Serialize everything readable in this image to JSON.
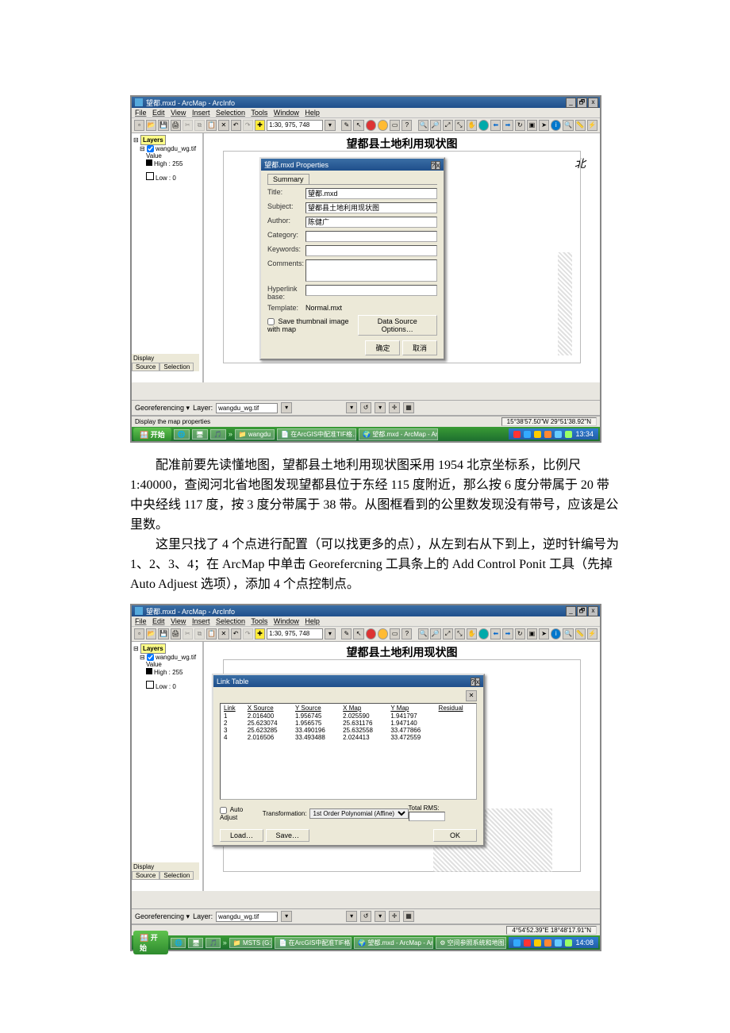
{
  "app": {
    "title": "望都.mxd - ArcMap - ArcInfo"
  },
  "win_ext": {
    "min": "_",
    "max": "🗗",
    "close": "x"
  },
  "menus": [
    "File",
    "Edit",
    "View",
    "Insert",
    "Selection",
    "Tools",
    "Window",
    "Help"
  ],
  "scale": "1:30, 975, 748",
  "toc": {
    "root": "Layers",
    "layer": "wangdu_wg.tif",
    "value_label": "Value",
    "high": "High : 255",
    "low": "Low : 0"
  },
  "toc_tabs": {
    "display": "Display",
    "source": "Source",
    "selection": "Selection"
  },
  "map": {
    "title": "望都县土地利用现状图",
    "north_hint": "北"
  },
  "props": {
    "dlg_title": "望都.mxd Properties",
    "tab": "Summary",
    "lbl_title": "Title:",
    "v_title": "望都.mxd",
    "lbl_subject": "Subject:",
    "v_subject": "望都县土地利用现状图",
    "lbl_author": "Author:",
    "v_author": "陈健广",
    "lbl_category": "Category:",
    "lbl_keywords": "Keywords:",
    "lbl_comments": "Comments:",
    "lbl_hlink": "Hyperlink base:",
    "lbl_template": "Template:",
    "v_template": "Normal.mxt",
    "cb_thumb": "Save thumbnail image with map",
    "btn_dso": "Data Source Options…",
    "btn_ok": "确定",
    "btn_cancel": "取消"
  },
  "georef": {
    "label": "Georeferencing ▾",
    "layer_lbl": "Layer:",
    "layer_val": "wangdu_wg.tif"
  },
  "status1": {
    "msg": "Display the map properties",
    "coords": "15°38'57.50\"W  29°51'38.92\"N"
  },
  "status2": {
    "msg": "",
    "coords": "4°54'52.39\"E  18°48'17.91\"N"
  },
  "taskbar1": {
    "start": "开始",
    "folder": "wangdu",
    "doc": "在ArcGIS中配准TIF格…",
    "app": "望都.mxd - ArcMap - Arc…",
    "clock": "13:34"
  },
  "taskbar2": {
    "start": "开始",
    "folder": "MSTS (G:)",
    "doc": "在ArcGIS中配准TIF格…",
    "app": "望都.mxd - ArcMap - Ar…",
    "extra": "空间参照系统和地图…",
    "clock": "14:08"
  },
  "para1": "配准前要先读懂地图，望都县土地利用现状图采用 1954 北京坐标系，比例尺 1:40000，查阅河北省地图发现望都县位于东经 115 度附近，那么按 6 度分带属于 20 带中央经线 117 度，按 3 度分带属于 38 带。从图框看到的公里数发现没有带号，应该是公里数。",
  "para2": "这里只找了 4 个点进行配置（可以找更多的点），从左到右从下到上，逆时针编号为 1、2、3、4；在 ArcMap 中单击 Georefercning 工具条上的 Add Control Ponit 工具（先掉 Auto Adjuest 选项），添加 4 个点控制点。",
  "linktbl": {
    "title": "Link Table",
    "hdr": [
      "Link",
      "X Source",
      "Y Source",
      "X Map",
      "Y Map",
      "Residual"
    ],
    "rows": [
      [
        "1",
        "2.016400",
        "1.956745",
        "2.025590",
        "1.941797",
        ""
      ],
      [
        "2",
        "25.623074",
        "1.956575",
        "25.631176",
        "1.947140",
        ""
      ],
      [
        "3",
        "25.623285",
        "33.490196",
        "25.632558",
        "33.477866",
        ""
      ],
      [
        "4",
        "2.016506",
        "33.493488",
        "2.024413",
        "33.472559",
        ""
      ]
    ],
    "auto": "Auto Adjust",
    "trans_lbl": "Transformation:",
    "trans_val": "1st Order Polynomial (Affine)",
    "rms_lbl": "Total RMS:",
    "btn_load": "Load…",
    "btn_save": "Save…",
    "btn_ok": "OK"
  }
}
